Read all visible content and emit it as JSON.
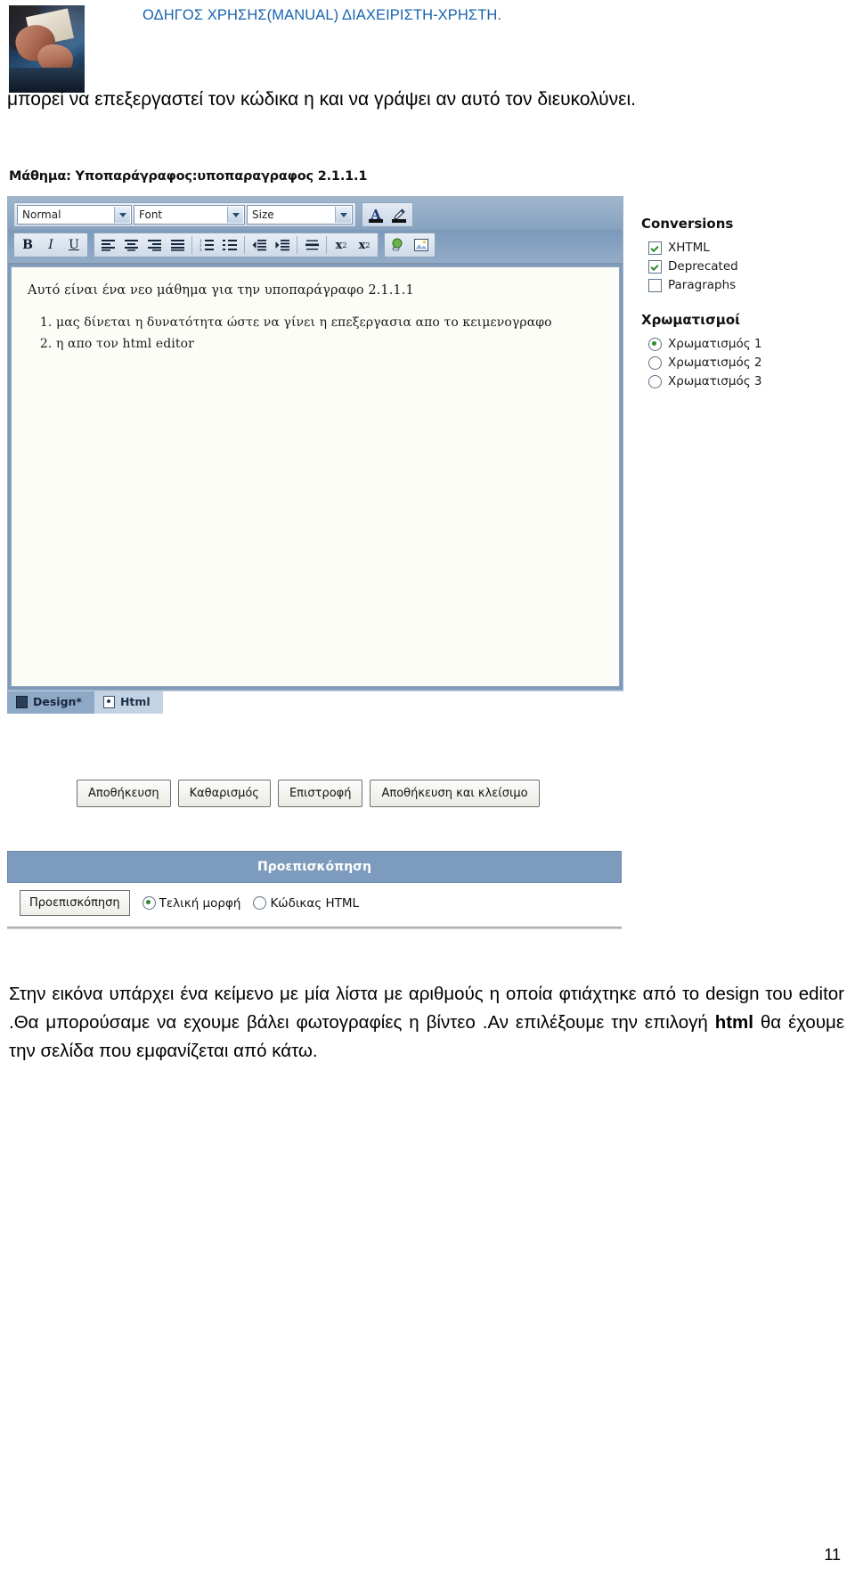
{
  "header": {
    "title": "ΟΔΗΓΟΣ ΧΡΗΣΗΣ(MANUAL) ΔΙΑΧΕΙΡΙΣΤΗ-ΧΡΗΣΤΗ.",
    "photo_alt": "hands-typing-photo",
    "title_color": "#1763ad"
  },
  "intro_line": "μπορεί να επεξεργαστεί τον κώδικα η και να γράψει αν αυτό τον διευκολύνει.",
  "screenshot": {
    "title": "Μάθημα: Υποπαράγραφος:υποπαραγραφος 2.1.1.1",
    "toolbar": {
      "style_select": "Normal",
      "font_select": "Font",
      "size_select": "Size",
      "font_color": "A",
      "highlight": "highlight-pen",
      "bold": "B",
      "italic": "I",
      "underline": "U",
      "align_left": "align-left",
      "align_center": "align-center",
      "align_right": "align-right",
      "align_justify": "align-justify",
      "ordered_list": "ordered-list",
      "unordered_list": "unordered-list",
      "indent": "indent",
      "outdent": "outdent",
      "horizontal_rule": "horizontal-rule",
      "subscript": "x₂",
      "superscript": "x²",
      "insert_link": "insert-link",
      "insert_image": "insert-image"
    },
    "content": {
      "paragraph": "Αυτό είναι ένα νεο μάθημα για την υποπαράγραφο 2.1.1.1",
      "list": [
        "μας δίνεται η δυνατότητα  ώστε να γίνει η επεξεργασια απο το κειμενογραφο",
        "η απο τον html editor"
      ]
    },
    "tabs": [
      {
        "label": "Design*",
        "icon": "design-icon",
        "active": true
      },
      {
        "label": "Html",
        "icon": "html-icon",
        "active": false
      }
    ],
    "side_panel": {
      "conversions_title": "Conversions",
      "conversions": [
        {
          "label": "XHTML",
          "checked": true
        },
        {
          "label": "Deprecated",
          "checked": true
        },
        {
          "label": "Paragraphs",
          "checked": false
        }
      ],
      "colors_title": "Χρωματισμοί",
      "colors": [
        {
          "label": "Χρωματισμός 1",
          "selected": true
        },
        {
          "label": "Χρωματισμός 2",
          "selected": false
        },
        {
          "label": "Χρωματισμός 3",
          "selected": false
        }
      ]
    },
    "buttons": [
      "Αποθήκευση",
      "Καθαρισμός",
      "Επιστροφή",
      "Αποθήκευση και κλείσιμο"
    ],
    "preview": {
      "bar_title": "Προεπισκόπηση",
      "button": "Προεπισκόπηση",
      "options": [
        {
          "label": "Τελική μορφή",
          "selected": true
        },
        {
          "label": "Κώδικας HTML",
          "selected": false
        }
      ]
    }
  },
  "body_paragraph": {
    "part1": "Στην εικόνα υπάρχει ένα κείμενο με μία λίστα με αριθμούς  η οποία φτιάχτηκε από το design του editor  .Θα μπορούσαμε να εχουμε βάλει φωτογραφίες η βίντεο .Αν επιλέξουμε την επιλογή  ",
    "emphasis": "html",
    "part2": " θα έχουμε την σελίδα που εμφανίζεται από κάτω."
  },
  "page_number": "11"
}
